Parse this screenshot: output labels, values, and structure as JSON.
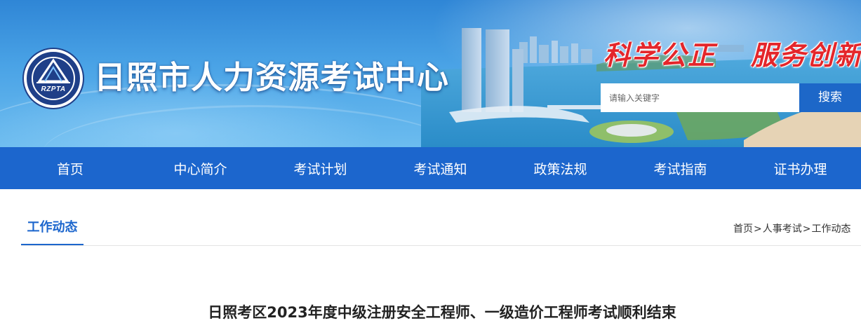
{
  "header": {
    "logo_text": "RZPTA",
    "site_title": "日照市人力资源考试中心",
    "slogan_1": "科学公正",
    "slogan_2": "服务创新"
  },
  "search": {
    "placeholder": "请输入关键字",
    "button_label": "搜索"
  },
  "nav": {
    "items": [
      {
        "label": "首页"
      },
      {
        "label": "中心简介"
      },
      {
        "label": "考试计划"
      },
      {
        "label": "考试通知"
      },
      {
        "label": "政策法规"
      },
      {
        "label": "考试指南"
      },
      {
        "label": "证书办理"
      }
    ]
  },
  "section": {
    "title": "工作动态"
  },
  "breadcrumb": {
    "items": [
      "首页",
      "人事考试",
      "工作动态"
    ],
    "separator": ">"
  },
  "article": {
    "title": "日照考区2023年度中级注册安全工程师、一级造价工程师考试顺利结束"
  },
  "colors": {
    "nav_bg": "#1c66cd",
    "accent_blue": "#1c66cd",
    "slogan_red": "#e4262b"
  }
}
